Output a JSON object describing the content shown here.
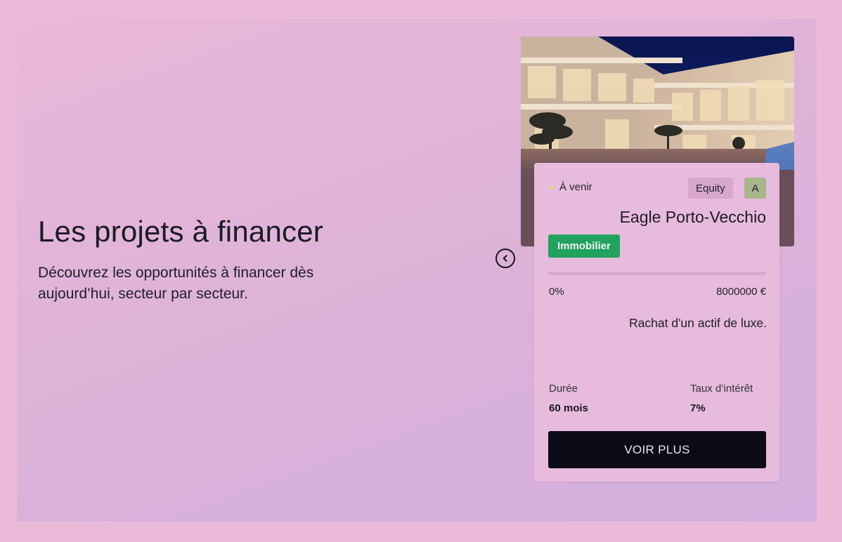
{
  "hero": {
    "title": "Les projets à financer",
    "subtitle": "Découvrez les opportunités à financer dès aujourd’hui, secteur par secteur."
  },
  "carousel": {
    "prev_icon": "chevron-left-circle-icon"
  },
  "project": {
    "status": "À venir",
    "status_color": "#e6d483",
    "badge_type": "Equity",
    "grade": "A",
    "name": "Eagle Porto-Vecchio",
    "sector": "Immobilier",
    "sector_color": "#21a35d",
    "progress_percent": 0,
    "progress_label": "0%",
    "goal": "8000000 €",
    "description": "Rachat d'un actif de luxe.",
    "duration_label": "Durée",
    "duration_value": "60 mois",
    "rate_label": "Taux d’intérêt",
    "rate_value": "7%",
    "cta": "VOIR PLUS"
  },
  "colors": {
    "page_background": "#ecbad9",
    "card_background": "#e7bbdc",
    "cta_background": "#0b0b16"
  }
}
